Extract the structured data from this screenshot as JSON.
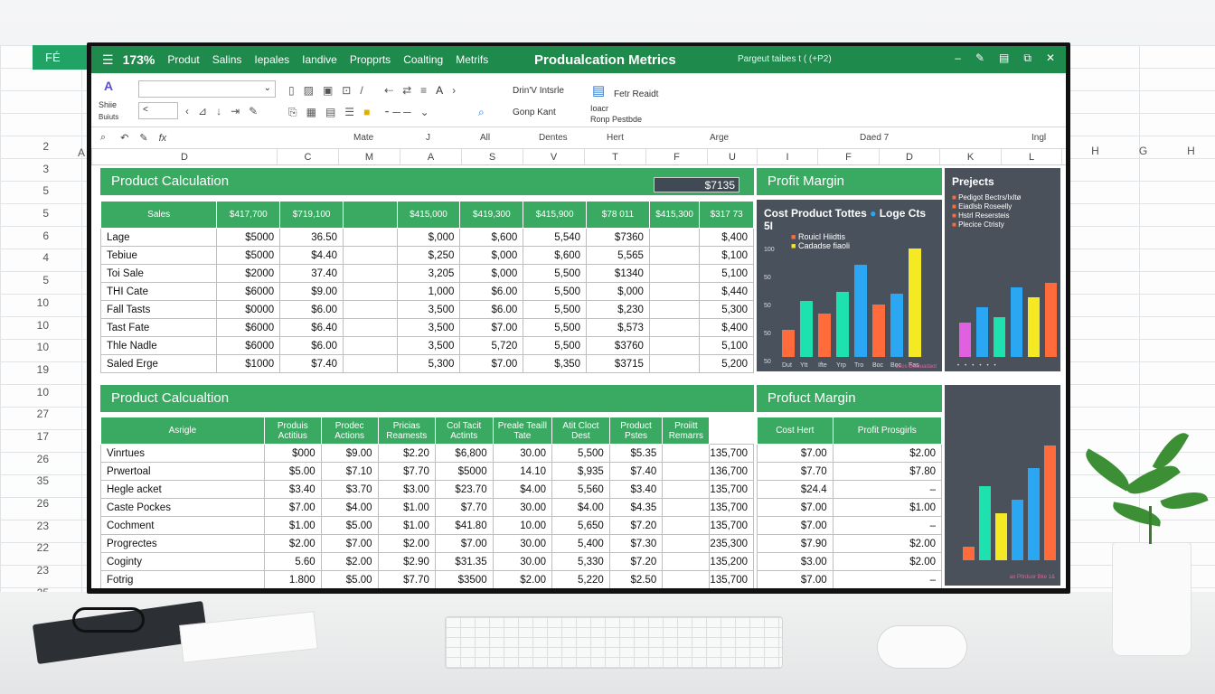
{
  "app": {
    "title": "Produalcation Metrics",
    "zoom": "173%",
    "menu": [
      "Produt",
      "Salins",
      "Iepales",
      "Iandive",
      "Propprts",
      "Coalting",
      "Metrifs"
    ],
    "file_label": "Pargeut taibes t ( (+P2)",
    "window_buttons": [
      "–",
      "✎",
      "▤",
      "⧉",
      "✕"
    ]
  },
  "background": {
    "green_tab": "FÉ",
    "row_numbers": [
      "2",
      "3",
      "5",
      "5",
      "6",
      "4",
      "5",
      "10",
      "10",
      "10",
      "19",
      "10",
      "27",
      "17",
      "26",
      "35",
      "26",
      "23",
      "22",
      "23",
      "25"
    ],
    "col_letters": [
      "H",
      "G",
      "H"
    ],
    "left_col": "A"
  },
  "ribbon": {
    "left_top": "Abc",
    "left_mid": "Shiie",
    "left_bot": "Buiuts",
    "name_box": "",
    "name_box2": "<",
    "fonts1": "Drin'V Intsrle",
    "fonts2": "Gonp Kant",
    "right1": "Fetr Reaidt",
    "right2": "Ioacr",
    "right3": "Ronp Pestbde"
  },
  "formula_bar": {
    "cell": "fx",
    "labels": [
      "Mate",
      "J",
      "All",
      "Dentes",
      "Hert",
      "Arge",
      "Daed 7",
      "Ingl"
    ]
  },
  "columns": [
    "D",
    "C",
    "M",
    "A",
    "S",
    "V",
    "T",
    "F",
    "U",
    "I",
    "F",
    "D",
    "K",
    "L"
  ],
  "section1": {
    "title": "Product Calculation",
    "value_box": "$7135",
    "headers": [
      "Sales",
      "$417,700",
      "$719,100",
      "",
      "$415,000",
      "$419,300",
      "$415,900",
      "$78 011",
      "$415,300",
      "$317 73"
    ],
    "rows": [
      [
        "Lage",
        "$5000",
        "36.50",
        "",
        "$,000",
        "$,600",
        "5,540",
        "$7360",
        "",
        "$,400"
      ],
      [
        "Tebiue",
        "$5000",
        "$4.40",
        "",
        "$,250",
        "$,000",
        "$,600",
        "5,565",
        "",
        "$,100"
      ],
      [
        "Toi Sale",
        "$2000",
        "37.40",
        "",
        "3,205",
        "$,000",
        "5,500",
        "$1340",
        "",
        "5,100"
      ],
      [
        "THI Cate",
        "$6000",
        "$9.00",
        "",
        "1,000",
        "$6.00",
        "5,500",
        "$,000",
        "",
        "$,440"
      ],
      [
        "Fall Tasts",
        "$0000",
        "$6.00",
        "",
        "3,500",
        "$6.00",
        "5,500",
        "$,230",
        "",
        "5,300"
      ],
      [
        "Tast Fate",
        "$6000",
        "$6.40",
        "",
        "3,500",
        "$7.00",
        "5,500",
        "$,573",
        "",
        "$,400"
      ],
      [
        "Thle Nadle",
        "$6000",
        "$6.00",
        "",
        "3,500",
        "5,720",
        "5,500",
        "$3760",
        "",
        "5,100"
      ],
      [
        "Saled Erge",
        "$1000",
        "$7.40",
        "",
        "5,300",
        "$7.00",
        "$,350",
        "$3715",
        "",
        "5,200"
      ]
    ]
  },
  "section2": {
    "title": "Product Calcualtion",
    "headers": [
      "Asrigle",
      "Produis Actitius",
      "Prodec Actions",
      "Pricias Reamests",
      "Col Tacit Actints",
      "Preale Teaill Tate",
      "Atit Cloct Dest",
      "Product Pstes",
      "Proiitt Remarrs"
    ],
    "rows": [
      [
        "Vinrtues",
        "$000",
        "$9.00",
        "$2.20",
        "$6,800",
        "30.00",
        "5,500",
        "$5.35",
        "",
        "135,700"
      ],
      [
        "Prwertoal",
        "$5.00",
        "$7.10",
        "$7.70",
        "$5000",
        "14.10",
        "$,935",
        "$7.40",
        "",
        "136,700"
      ],
      [
        "Hegle acket",
        "$3.40",
        "$3.70",
        "$3.00",
        "$23.70",
        "$4.00",
        "5,560",
        "$3.40",
        "",
        "135,700"
      ],
      [
        "Caste Pockes",
        "$7.00",
        "$4.00",
        "$1.00",
        "$7.70",
        "30.00",
        "$4.00",
        "$4.35",
        "",
        "135,700"
      ],
      [
        "Cochment",
        "$1.00",
        "$5.00",
        "$1.00",
        "$41.80",
        "10.00",
        "5,650",
        "$7.20",
        "",
        "135,700"
      ],
      [
        "Progrectes",
        "$2.00",
        "$7.00",
        "$2.00",
        "$7.00",
        "30.00",
        "5,400",
        "$7.30",
        "",
        "235,300"
      ],
      [
        "Coginty",
        "5.60",
        "$2.00",
        "$2.90",
        "$31.35",
        "30.00",
        "5,330",
        "$7.20",
        "",
        "135,200"
      ],
      [
        "Fotrig",
        "1.800",
        "$5.00",
        "$7.70",
        "$3500",
        "$2.00",
        "5,220",
        "$2.50",
        "",
        "135,700"
      ]
    ]
  },
  "profit1": {
    "title": "Profit Margin",
    "chart_title": "Cost Product Tottes",
    "chart_title2": "Loge Cts 5I",
    "legend": [
      "Rouicl Hiidtis",
      "Cadadse fiaoli"
    ],
    "y_ticks": [
      "100",
      "50",
      "50",
      "50",
      "50"
    ],
    "x_labels": [
      "Dut",
      "Ytt",
      "Ifte",
      "Yrp",
      "Tro",
      "Boc",
      "Boc",
      "Fas"
    ],
    "footnote": "Leos Dleuuadaot"
  },
  "projects": {
    "title": "Prejects",
    "legend": [
      "Pedigot Bectrs/Ixltø",
      "Eiadlsb Roseelly",
      "Hstrl Resersteis",
      "Plecice Ctristy"
    ]
  },
  "profit2": {
    "title": "Profuct Margin",
    "headers": [
      "Cost Hert",
      "Profit Prosgirls"
    ],
    "rows": [
      [
        "$7.00",
        "$2.00"
      ],
      [
        "$7.70",
        "$7.80"
      ],
      [
        "$24.4",
        "–"
      ],
      [
        "$7.00",
        "$1.00"
      ],
      [
        "$7.00",
        "–"
      ],
      [
        "$7.90",
        "$2.00"
      ],
      [
        "$3.00",
        "$2.00"
      ],
      [
        "$7.00",
        "–"
      ]
    ],
    "footnote": "ao Ptlrduor Bke 1&"
  },
  "chart_data": [
    {
      "type": "bar",
      "title": "Cost Product Tottes",
      "categories": [
        "Dut",
        "Ytt",
        "Ifte",
        "Yrp",
        "Tro",
        "Boc",
        "Boc",
        "Fas"
      ],
      "series": [
        {
          "values": [
            25,
            52,
            40,
            60,
            85,
            48,
            58,
            100
          ]
        }
      ],
      "colors": [
        "#ff6b3a",
        "#1de2b0",
        "#ff6b3a",
        "#1de2b0",
        "#2aa6f2",
        "#ff6b3a",
        "#2aa6f2",
        "#f5e924"
      ]
    },
    {
      "type": "bar",
      "title": "Prejects",
      "series": [
        {
          "values": [
            35,
            50,
            40,
            70,
            60,
            75
          ]
        }
      ],
      "colors": [
        "#e060e0",
        "#2aa6f2",
        "#1de2b0",
        "#2aa6f2",
        "#f5e924",
        "#ff6b3a"
      ]
    },
    {
      "type": "bar",
      "title": "Profuct Margin",
      "series": [
        {
          "values": [
            10,
            55,
            35,
            45,
            68,
            85
          ]
        }
      ],
      "colors": [
        "#ff6b3a",
        "#1de2b0",
        "#f5e924",
        "#2aa6f2",
        "#2aa6f2",
        "#ff6b3a"
      ]
    }
  ]
}
